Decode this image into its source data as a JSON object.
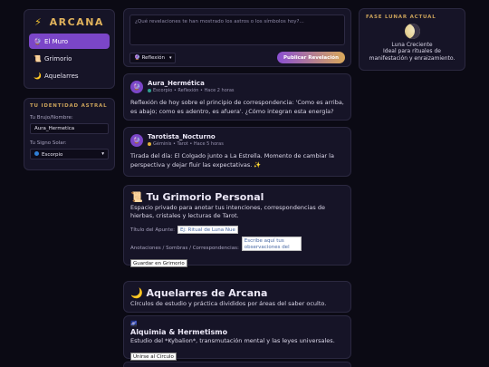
{
  "brand": {
    "icon": "⚡",
    "name": "ARCANA"
  },
  "nav": [
    {
      "icon": "🔮",
      "icon_name": "crystal-ball-icon",
      "label": "El Muro",
      "active": true
    },
    {
      "icon": "📜",
      "icon_name": "scroll-icon",
      "label": "Grimorio",
      "active": false
    },
    {
      "icon": "🌙",
      "icon_name": "moon-icon",
      "label": "Aquelarres",
      "active": false
    }
  ],
  "identity": {
    "heading": "TU IDENTIDAD ASTRAL",
    "name_label": "Tu Brujo/Nombre:",
    "name_value": "Aura_Hermetica",
    "sign_label": "Tu Signo Solar:",
    "sign_value": "Escorpio"
  },
  "composer": {
    "placeholder": "¿Qué revelaciones te han mostrado los astros o los símbolos hoy?...",
    "category": "🔮 Reflexión",
    "publish_label": "Publicar Revelación"
  },
  "posts": [
    {
      "avatar": "🔮",
      "author": "Aura_Hermética",
      "meta": "Escorpio • Reflexión • Hace 2 horas",
      "sign_color": "#2f9e8f",
      "body": "Reflexión de hoy sobre el principio de correspondencia: 'Como es arriba, es abajo; como es adentro, es afuera'. ¿Cómo integran esta energía?"
    },
    {
      "avatar": "🔮",
      "author": "Tarotista_Nocturno",
      "meta": "Géminis • Tarot • Hace 5 horas",
      "sign_color": "#e2b33a",
      "body": "Tirada del día: El Colgado junto a La Estrella. Momento de cambiar la perspectiva y dejar fluir las expectativas. ✨"
    }
  ],
  "grimoire": {
    "title": "📜 Tu Grimorio Personal",
    "description": "Espacio privado para anotar tus intenciones, correspondencias de hierbas, cristales y lecturas de Tarot.",
    "title_label": "Título del Apunte:",
    "title_placeholder": "Ej: Ritual de Luna Nue",
    "notes_label": "Anotaciones / Sombras / Correspondencias:",
    "notes_placeholder": "Escribe aquí tus observaciones del",
    "save_label": "Guardar en Grimorio"
  },
  "covens": {
    "title": "🌙 Aquelarres de Arcana",
    "description": "Círculos de estudio y práctica divididos por áreas del saber oculto.",
    "items": [
      {
        "icon": "🌌",
        "title": "Alquimia & Hermetismo",
        "description": "Estudio del *Kybalion*, transmutación mental y las leyes universales.",
        "join_label": "Unirse al Círculo"
      }
    ]
  },
  "moon": {
    "heading": "FASE LUNAR ACTUAL",
    "phase": "Luna Creciente",
    "description": "Ideal para rituales de manifestación y enraizamiento."
  }
}
